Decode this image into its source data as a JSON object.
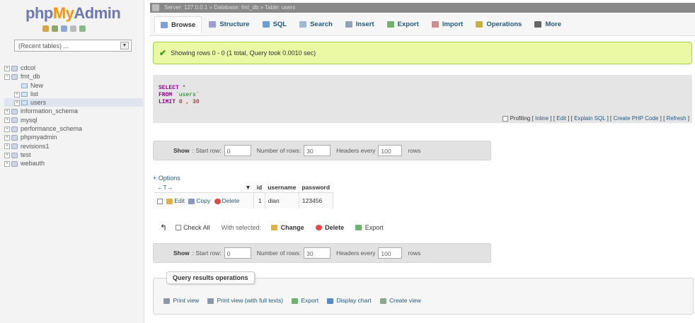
{
  "logo": {
    "php": "php",
    "my": "My",
    "admin": "Admin"
  },
  "recent_tables": "(Recent tables) ...",
  "tree": [
    {
      "label": "cdcol",
      "type": "db",
      "expanded": false
    },
    {
      "label": "fmt_db",
      "type": "db",
      "expanded": true
    },
    {
      "label": "New",
      "type": "new",
      "indent": 1
    },
    {
      "label": "list",
      "type": "table",
      "indent": 1
    },
    {
      "label": "users",
      "type": "table",
      "indent": 1,
      "selected": true
    },
    {
      "label": "information_schema",
      "type": "db",
      "expanded": false
    },
    {
      "label": "mysql",
      "type": "db",
      "expanded": false
    },
    {
      "label": "performance_schema",
      "type": "db",
      "expanded": false
    },
    {
      "label": "phpmyadmin",
      "type": "db",
      "expanded": false
    },
    {
      "label": "revisions1",
      "type": "db",
      "expanded": false
    },
    {
      "label": "test",
      "type": "db",
      "expanded": false
    },
    {
      "label": "webauth",
      "type": "db",
      "expanded": false
    }
  ],
  "breadcrumb": "Server: 127.0.0.1 » Database: fmt_db » Table: users",
  "tabs": [
    {
      "label": "Browse",
      "active": true,
      "color": "#7aa0d6"
    },
    {
      "label": "Structure",
      "active": false,
      "color": "#9c9cd8"
    },
    {
      "label": "SQL",
      "active": false,
      "color": "#6f9ed6"
    },
    {
      "label": "Search",
      "active": false,
      "color": "#9fb8d8"
    },
    {
      "label": "Insert",
      "active": false,
      "color": "#8fa4b8"
    },
    {
      "label": "Export",
      "active": false,
      "color": "#6eb26e"
    },
    {
      "label": "Import",
      "active": false,
      "color": "#c88e8e"
    },
    {
      "label": "Operations",
      "active": false,
      "color": "#c8b048"
    },
    {
      "label": "More",
      "active": false,
      "color": "#666666"
    }
  ],
  "success_message": "Showing rows 0 - 0 (1 total, Query took 0.0010 sec)",
  "sql": {
    "select": "SELECT",
    "star": " *",
    "from": "FROM",
    "table": " `users`",
    "limit": "LIMIT",
    "range": " 0 , 30"
  },
  "sql_links": {
    "profiling": "Profiling",
    "inline": "Inline",
    "edit": "Edit",
    "explain": "Explain SQL",
    "php": "Create PHP Code",
    "refresh": "Refresh"
  },
  "nav": {
    "show": "Show",
    "start_row": "Start row:",
    "start_val": "0",
    "num_rows": "Number of rows:",
    "num_val": "30",
    "headers_every": "Headers every",
    "headers_val": "100",
    "rows": "rows"
  },
  "options": "+ Options",
  "table": {
    "sort_label": "←T→",
    "columns": [
      "id",
      "username",
      "password"
    ],
    "rows": [
      {
        "edit": "Edit",
        "copy": "Copy",
        "delete": "Delete",
        "id": "1",
        "username": "dian",
        "password": "123456"
      }
    ]
  },
  "bulk": {
    "check_all": "Check All",
    "with_selected": "With selected:",
    "change": "Change",
    "delete": "Delete",
    "export": "Export"
  },
  "qro": {
    "title": "Query results operations",
    "links": [
      "Print view",
      "Print view (with full texts)",
      "Export",
      "Display chart",
      "Create view"
    ]
  }
}
